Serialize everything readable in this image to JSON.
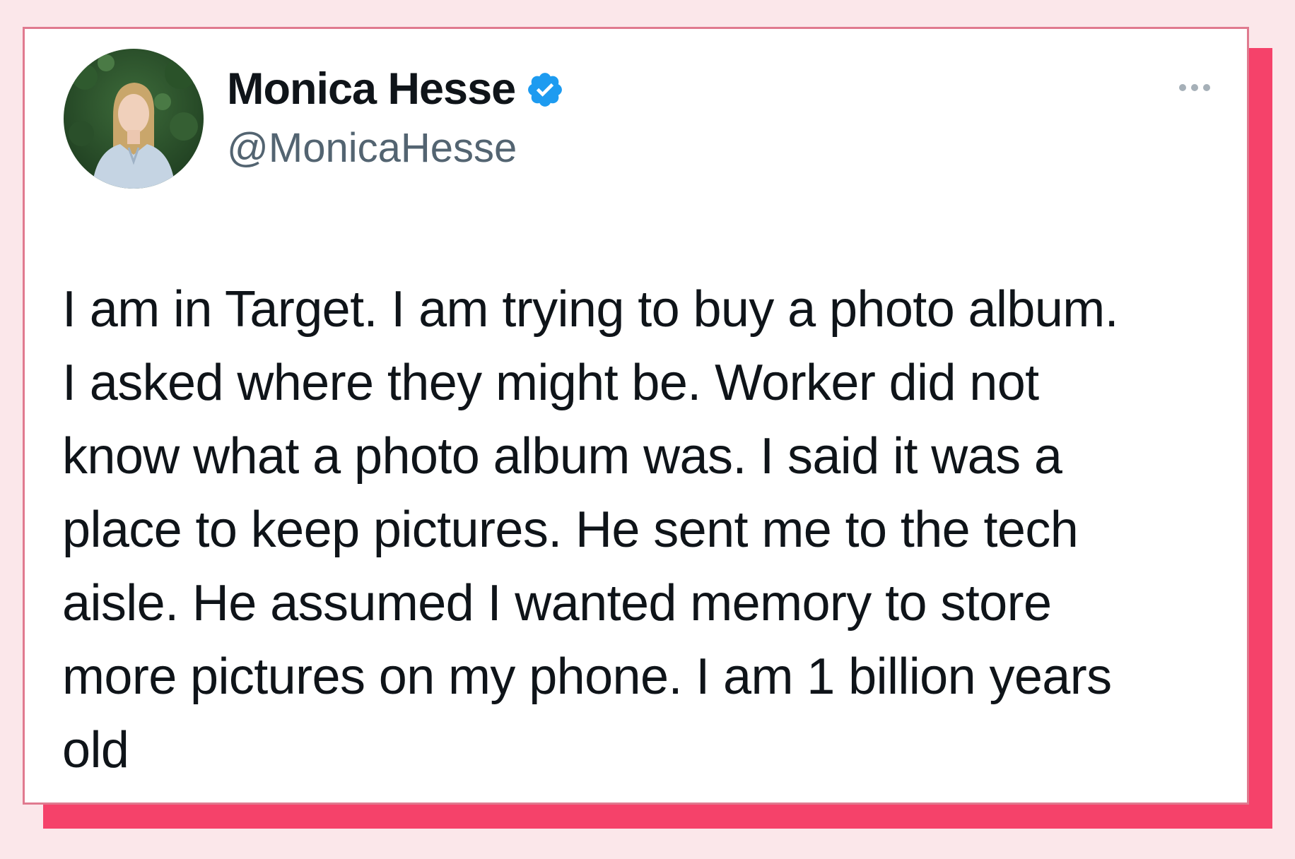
{
  "tweet": {
    "author": {
      "display_name": "Monica Hesse",
      "handle": "@MonicaHesse",
      "verified": true,
      "avatar_icon": "profile-photo"
    },
    "more_icon": "ellipsis-icon",
    "text_lines": [
      "I am in Target. I am trying to buy a photo album.",
      "I asked where they might be. Worker did not",
      "know what a photo album was. I said it was a",
      "place to keep pictures. He sent me to the tech",
      "aisle. He assumed I wanted memory to store",
      "more pictures on my phone. I am 1 billion years",
      "old"
    ]
  },
  "colors": {
    "page_background": "#fbe7ea",
    "card_border": "#e07a8f",
    "card_shadow": "#f5426a",
    "verified_badge": "#1d9bf0",
    "text": "#0f1419",
    "secondary_text": "#536471"
  }
}
